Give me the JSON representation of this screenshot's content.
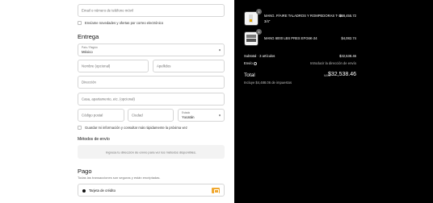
{
  "contact": {
    "email_placeholder": "Email o número de teléfono móvil",
    "newsletter_label": "Envíame novedades y ofertas por correo electrónico"
  },
  "delivery": {
    "title": "Entrega",
    "country_label": "País / Región",
    "country_value": "México",
    "first_name_placeholder": "Nombre (opcional)",
    "last_name_placeholder": "Apellidos",
    "address_placeholder": "Dirección",
    "apartment_placeholder": "Casa, apartamento, etc. (opcional)",
    "postal_placeholder": "Código postal",
    "city_placeholder": "Ciudad",
    "state_label": "Estado",
    "state_value": "Yucatán",
    "save_info_label": "Guardar mi información y consultar más rápidamente la próxima vez"
  },
  "shipping": {
    "title": "Métodos de envío",
    "message": "Ingresa tu dirección de envío para ver los métodos disponibles."
  },
  "payment": {
    "title": "Pago",
    "subtitle": "Todas las transacciones son seguras y están encriptadas.",
    "option_label": "Tarjeta de crédito"
  },
  "summary": {
    "items": [
      {
        "qty": "1",
        "name": "MANG. P/AIRE TALADROS Y ROMPEDORAS T-1A",
        "name_line2": "3/4\"",
        "price": "$28,455.72"
      },
      {
        "qty": "1",
        "name": "MANG 6000 LBS PRES EFG6K-24",
        "price": "$4,082.74"
      }
    ],
    "subtotal_label": "Subtotal · 3 artículos",
    "subtotal_value": "$32,538.46",
    "shipping_label": "Envío",
    "shipping_value": "Introducir la dirección de envío",
    "total_label": "Total",
    "currency": "MXN",
    "total_value": "$32,538.46",
    "taxes_note": "Incluye $4,488.06 de impuestos"
  }
}
